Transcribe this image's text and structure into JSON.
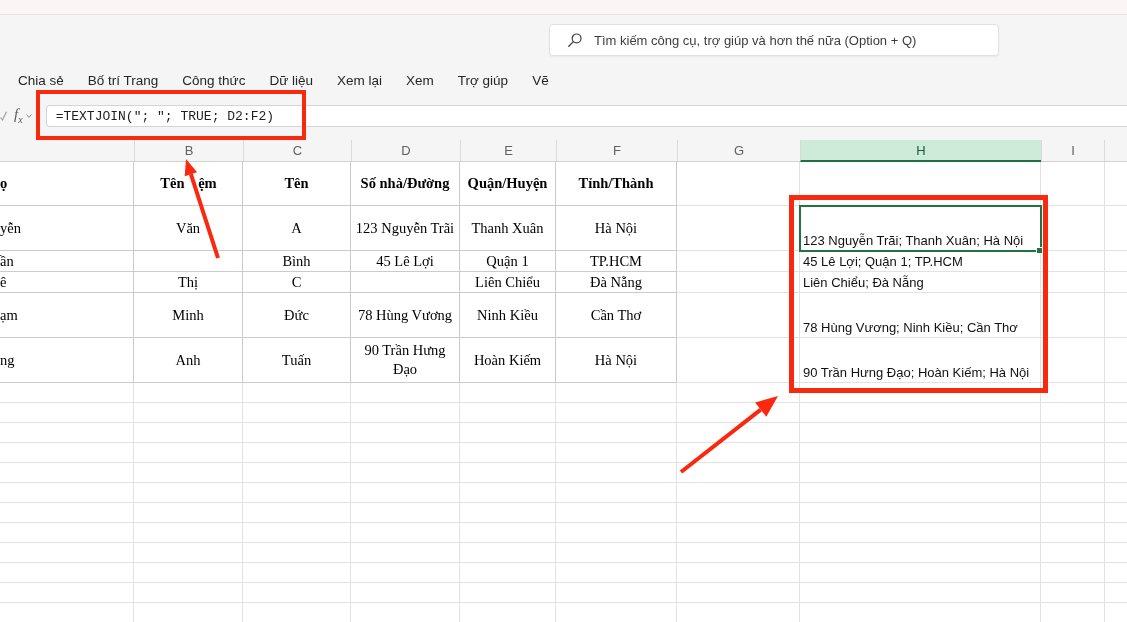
{
  "search": {
    "placeholder": "Tìm kiếm công cụ, trợ giúp và hơn thế nữa (Option + Q)"
  },
  "menu_tabs": [
    {
      "label": "Chia sẻ",
      "selected": false
    },
    {
      "label": "Bố trí Trang",
      "selected": false
    },
    {
      "label": "Công thức",
      "selected": false
    },
    {
      "label": "Dữ liệu",
      "selected": false
    },
    {
      "label": "Xem lại",
      "selected": false
    },
    {
      "label": "Xem",
      "selected": false
    },
    {
      "label": "Trợ giúp",
      "selected": false
    },
    {
      "label": "Vẽ",
      "selected": false
    }
  ],
  "formula_bar": {
    "function_label": "f$_{x}$",
    "formula": "=TEXTJOIN(\"; \"; TRUE; D2:F2)"
  },
  "sheet": {
    "column_headers": [
      {
        "label": "B",
        "selected": false
      },
      {
        "label": "C",
        "selected": false
      },
      {
        "label": "D",
        "selected": false
      },
      {
        "label": "E",
        "selected": false
      },
      {
        "label": "F",
        "selected": false
      },
      {
        "label": "G",
        "selected": false
      },
      {
        "label": "H",
        "selected": true
      },
      {
        "label": "I",
        "selected": false
      }
    ],
    "header_row": {
      "A": "ọ",
      "B": "Tên ệm",
      "C": "Tên",
      "D": "Số nhà/Đường",
      "E": "Quận/Huyện",
      "F": "Tỉnh/Thành"
    },
    "rows": [
      {
        "cells": {
          "A": "yễn",
          "B": "Văn",
          "C": "A",
          "D": "123 Nguyễn Trãi",
          "E": "Thanh Xuân",
          "F": "Hà Nội"
        },
        "result": {
          "text": "123 Nguyễn Trãi; Thanh Xuân; Hà Nội",
          "selected": true
        }
      },
      {
        "cells": {
          "A": "ần",
          "C": "Bình",
          "D": "45 Lê Lợi",
          "E": "Quận 1",
          "F": "TP.HCM"
        },
        "result": {
          "text": "45 Lê Lợi; Quận 1; TP.HCM",
          "selected": false
        }
      },
      {
        "cells": {
          "A": "ê",
          "B": "Thị",
          "C": "C",
          "E": "Liên Chiểu",
          "F": "Đà Nẵng"
        },
        "result": {
          "text": "Liên Chiểu; Đà Nẵng",
          "selected": false
        }
      },
      {
        "cells": {
          "A": "ạm",
          "B": "Minh",
          "C": "Đức",
          "D": "78 Hùng Vương",
          "E": "Ninh Kiều",
          "F": "Cần Thơ"
        },
        "result": {
          "text": "78 Hùng Vương; Ninh Kiều; Cần Thơ",
          "selected": false
        }
      },
      {
        "cells": {
          "A": "ng",
          "B": "Anh",
          "C": "Tuấn",
          "D": "90 Trần Hưng Đạo",
          "E": "Hoàn Kiếm",
          "F": "Hà Nội"
        },
        "result": {
          "text": "90 Trần Hưng Đạo; Hoàn Kiếm; Hà Nội",
          "selected": false
        }
      }
    ]
  }
}
